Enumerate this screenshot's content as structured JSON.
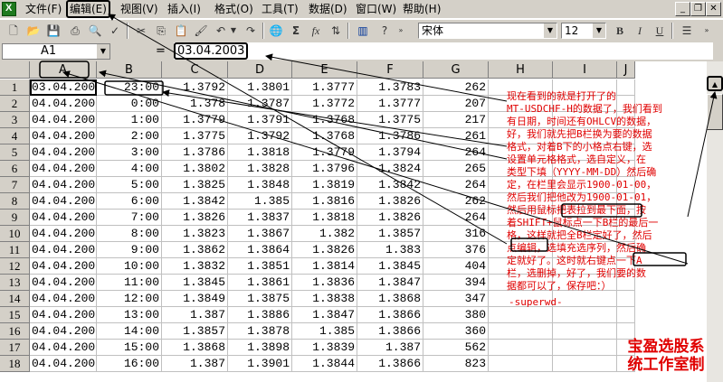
{
  "menu": {
    "items": [
      "文件(F)",
      "编辑(E)",
      "视图(V)",
      "插入(I)",
      "格式(O)",
      "工具(T)",
      "数据(D)",
      "窗口(W)",
      "帮助(H)"
    ]
  },
  "toolbar": {
    "font_name": "宋体",
    "font_size": "12",
    "bold": "B",
    "italic": "I",
    "underline": "U"
  },
  "formula_bar": {
    "name_box": "A1",
    "equals": "=",
    "value": "03.04.2003"
  },
  "columns": [
    "A",
    "B",
    "C",
    "D",
    "E",
    "F",
    "G",
    "H",
    "I",
    "J"
  ],
  "rows": [
    {
      "n": "1",
      "a": "03.04.200",
      "b": "23:00",
      "c": "1.3792",
      "d": "1.3801",
      "e": "1.3777",
      "f": "1.3783",
      "g": "262"
    },
    {
      "n": "2",
      "a": "04.04.200",
      "b": "0:00",
      "c": "1.378",
      "d": "1.3787",
      "e": "1.3772",
      "f": "1.3777",
      "g": "207"
    },
    {
      "n": "3",
      "a": "04.04.200",
      "b": "1:00",
      "c": "1.3779",
      "d": "1.3791",
      "e": "1.3768",
      "f": "1.3775",
      "g": "217"
    },
    {
      "n": "4",
      "a": "04.04.200",
      "b": "2:00",
      "c": "1.3775",
      "d": "1.3792",
      "e": "1.3768",
      "f": "1.3786",
      "g": "261"
    },
    {
      "n": "5",
      "a": "04.04.200",
      "b": "3:00",
      "c": "1.3786",
      "d": "1.3818",
      "e": "1.3779",
      "f": "1.3794",
      "g": "264"
    },
    {
      "n": "6",
      "a": "04.04.200",
      "b": "4:00",
      "c": "1.3802",
      "d": "1.3828",
      "e": "1.3796",
      "f": "1.3824",
      "g": "265"
    },
    {
      "n": "7",
      "a": "04.04.200",
      "b": "5:00",
      "c": "1.3825",
      "d": "1.3848",
      "e": "1.3819",
      "f": "1.3842",
      "g": "264"
    },
    {
      "n": "8",
      "a": "04.04.200",
      "b": "6:00",
      "c": "1.3842",
      "d": "1.385",
      "e": "1.3816",
      "f": "1.3826",
      "g": "262"
    },
    {
      "n": "9",
      "a": "04.04.200",
      "b": "7:00",
      "c": "1.3826",
      "d": "1.3837",
      "e": "1.3818",
      "f": "1.3826",
      "g": "264"
    },
    {
      "n": "10",
      "a": "04.04.200",
      "b": "8:00",
      "c": "1.3823",
      "d": "1.3867",
      "e": "1.382",
      "f": "1.3857",
      "g": "316"
    },
    {
      "n": "11",
      "a": "04.04.200",
      "b": "9:00",
      "c": "1.3862",
      "d": "1.3864",
      "e": "1.3826",
      "f": "1.383",
      "g": "376"
    },
    {
      "n": "12",
      "a": "04.04.200",
      "b": "10:00",
      "c": "1.3832",
      "d": "1.3851",
      "e": "1.3814",
      "f": "1.3845",
      "g": "404"
    },
    {
      "n": "13",
      "a": "04.04.200",
      "b": "11:00",
      "c": "1.3845",
      "d": "1.3861",
      "e": "1.3836",
      "f": "1.3847",
      "g": "394"
    },
    {
      "n": "14",
      "a": "04.04.200",
      "b": "12:00",
      "c": "1.3849",
      "d": "1.3875",
      "e": "1.3838",
      "f": "1.3868",
      "g": "347"
    },
    {
      "n": "15",
      "a": "04.04.200",
      "b": "13:00",
      "c": "1.387",
      "d": "1.3886",
      "e": "1.3847",
      "f": "1.3866",
      "g": "380"
    },
    {
      "n": "16",
      "a": "04.04.200",
      "b": "14:00",
      "c": "1.3857",
      "d": "1.3878",
      "e": "1.385",
      "f": "1.3866",
      "g": "360"
    },
    {
      "n": "17",
      "a": "04.04.200",
      "b": "15:00",
      "c": "1.3868",
      "d": "1.3898",
      "e": "1.3839",
      "f": "1.387",
      "g": "562"
    },
    {
      "n": "18",
      "a": "04.04.200",
      "b": "16:00",
      "c": "1.387",
      "d": "1.3901",
      "e": "1.3844",
      "f": "1.3866",
      "g": "823"
    }
  ],
  "annotation": "现在看到的就是打开了的\nMT-USDCHF-H的数据了，我们看到\n有日期，时间还有OHLCV的数据，\n好，我们就先把B栏换为要的数据\n格式，对着B下的小格点右键，选\n设置单元格格式，选自定义，在\n类型下填（YYYY-MM-DD）然后确\n定，在栏里会显示1900-01-00，\n然后我们把他改为1900-01-01，\n然后用鼠标把表拉到最下面，按\n着SHIFT+鼠标点一下B栏的最后一\n格，这样就把全B栏定好了，然后\n点编辑，选填充选序列，然后确\n定就好了。这时就右键点一下A\n栏，选删掉，好了，我们要的数\n据都可以了，保存吧：）",
  "signature": "-superwd-",
  "stamp": "宝盈选股系\n统工作室制",
  "colors": {
    "annotation": "#e00000",
    "chrome": "#d4d0c8"
  }
}
